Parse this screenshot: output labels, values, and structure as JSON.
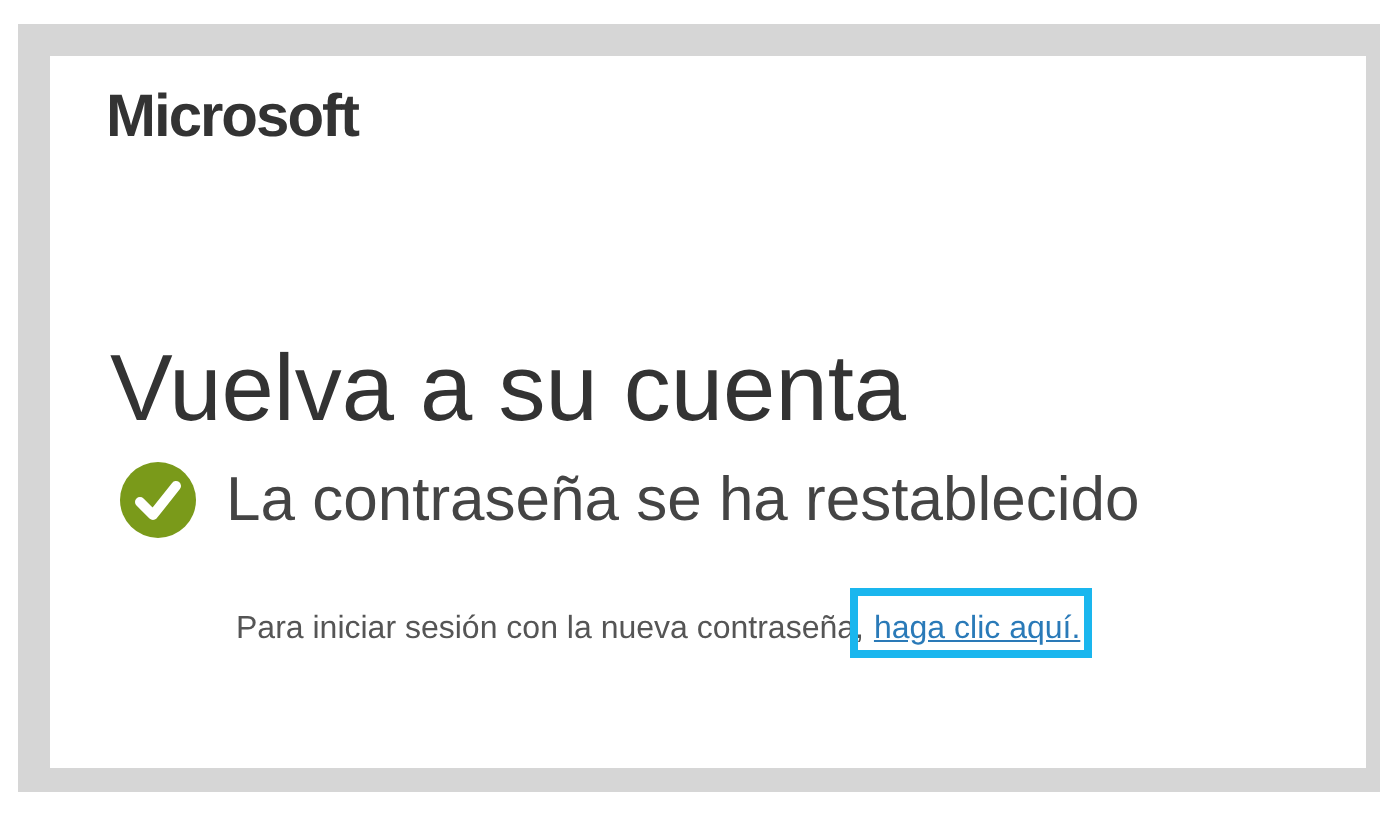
{
  "logo": "Microsoft",
  "heading": "Vuelva a su cuenta",
  "status": {
    "kind": "success",
    "text": "La contraseña se ha restablecido"
  },
  "message": {
    "text": "Para iniciar sesión con la nueva contraseña,",
    "link": {
      "text": "haga clic aquí.",
      "highlighted": true
    }
  }
}
